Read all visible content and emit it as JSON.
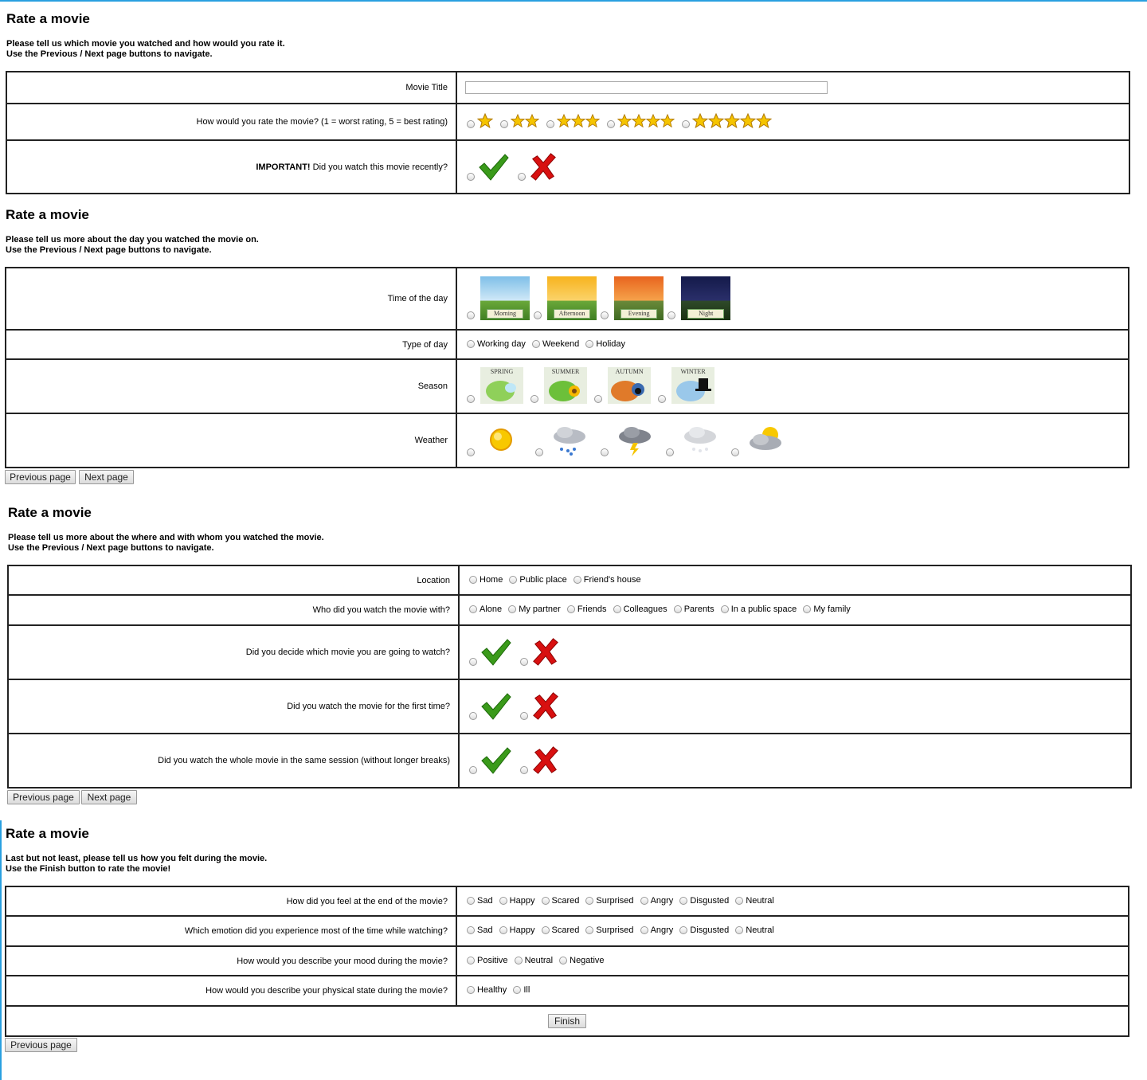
{
  "sections": [
    {
      "title": "Rate a movie",
      "intro1": "Please tell us which movie you watched and how would you rate it.",
      "intro2": "Use the Previous / Next page buttons to navigate.",
      "movie_title_label": "Movie Title",
      "movie_title_value": "",
      "rating_label": "How would you rate the movie? (1 = worst rating, 5 = best rating)",
      "rating_options": [
        1,
        2,
        3,
        4,
        5
      ],
      "important_bold": "IMPORTANT!",
      "important_rest": " Did you watch this movie recently?"
    },
    {
      "title": "Rate a movie",
      "intro1": "Please tell us more about the day you watched the movie on.",
      "intro2": "Use the Previous / Next page buttons to navigate.",
      "time_label": "Time of the day",
      "time_options": [
        "Morning",
        "Afternoon",
        "Evening",
        "Night"
      ],
      "daytype_label": "Type of day",
      "daytype_options": [
        "Working day",
        "Weekend",
        "Holiday"
      ],
      "season_label": "Season",
      "season_options": [
        "SPRING",
        "SUMMER",
        "AUTUMN",
        "WINTER"
      ],
      "weather_label": "Weather",
      "weather_icons": [
        "sunny-icon",
        "rain-icon",
        "thunderstorm-icon",
        "snow-icon",
        "partly-cloudy-icon"
      ],
      "prev": "Previous page",
      "next": "Next page"
    },
    {
      "title": "Rate a movie",
      "intro1": "Please tell us more about the where and with whom you watched the movie.",
      "intro2": "Use the Previous / Next page buttons to navigate.",
      "location_label": "Location",
      "location_options": [
        "Home",
        "Public place",
        "Friend's house"
      ],
      "with_label": "Who did you watch the movie with?",
      "with_options": [
        "Alone",
        "My partner",
        "Friends",
        "Colleagues",
        "Parents",
        "In a public space",
        "My family"
      ],
      "decide_label": "Did you decide which movie you are going to watch?",
      "first_label": "Did you watch the movie for the first time?",
      "whole_label": "Did you watch the whole movie in the same session (without longer breaks)",
      "prev": "Previous page",
      "next": "Next page"
    },
    {
      "title": "Rate a movie",
      "intro1": "Last but not least, please tell us how you felt during the movie.",
      "intro2": "Use the Finish button to rate the movie!",
      "end_label": "How did you feel at the end of the movie?",
      "end_options": [
        "Sad",
        "Happy",
        "Scared",
        "Surprised",
        "Angry",
        "Disgusted",
        "Neutral"
      ],
      "most_label": "Which emotion did you experience most of the time while watching?",
      "most_options": [
        "Sad",
        "Happy",
        "Scared",
        "Surprised",
        "Angry",
        "Disgusted",
        "Neutral"
      ],
      "mood_label": "How would you describe your mood during the movie?",
      "mood_options": [
        "Positive",
        "Neutral",
        "Negative"
      ],
      "physical_label": "How would you describe your physical state during the movie?",
      "physical_options": [
        "Healthy",
        "Ill"
      ],
      "finish": "Finish",
      "prev": "Previous page"
    }
  ],
  "colors": {
    "border": "#222222",
    "accent": "#29a0e0",
    "check": "#3a9a1a",
    "cross": "#d81010",
    "star": "#f5c400"
  }
}
